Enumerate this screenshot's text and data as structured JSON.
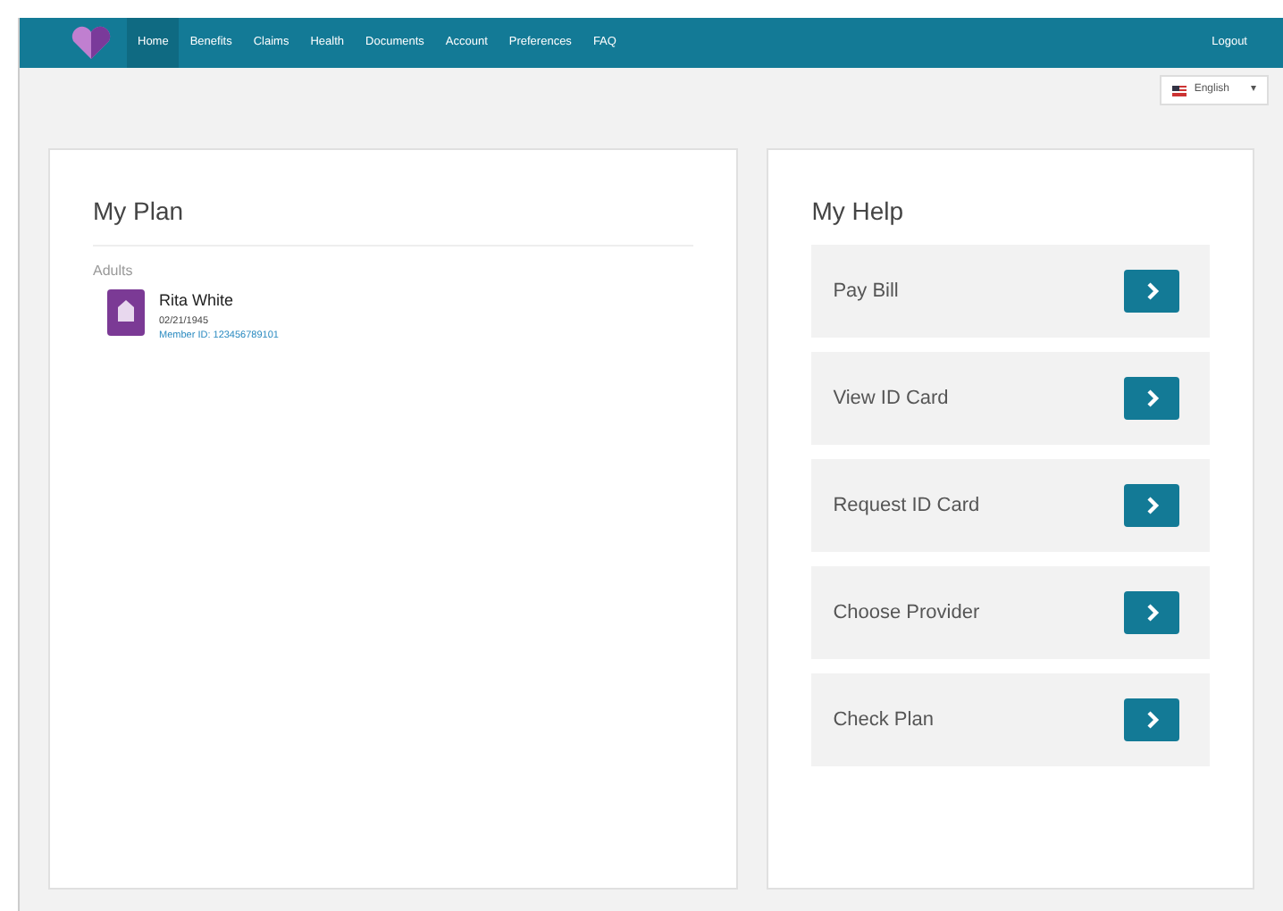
{
  "navbar": {
    "items": [
      {
        "label": "Home",
        "selected": true
      },
      {
        "label": "Benefits",
        "selected": false
      },
      {
        "label": "Claims",
        "selected": false
      },
      {
        "label": "Health",
        "selected": false
      },
      {
        "label": "Documents",
        "selected": false
      },
      {
        "label": "Account",
        "selected": false
      },
      {
        "label": "Preferences",
        "selected": false
      },
      {
        "label": "FAQ",
        "selected": false
      }
    ],
    "logout": "Logout"
  },
  "language": {
    "value": "English",
    "caret": "▾"
  },
  "my_plan": {
    "title": "My Plan",
    "group": "Adults",
    "members": [
      {
        "name": "Rita White",
        "dob": "02/21/1945",
        "member_id": "Member ID: 123456789101"
      }
    ]
  },
  "my_help": {
    "title": "My Help",
    "items": [
      {
        "label": "Pay Bill"
      },
      {
        "label": "View ID Card"
      },
      {
        "label": "Request ID Card"
      },
      {
        "label": "Choose Provider"
      },
      {
        "label": "Check Plan"
      }
    ]
  }
}
